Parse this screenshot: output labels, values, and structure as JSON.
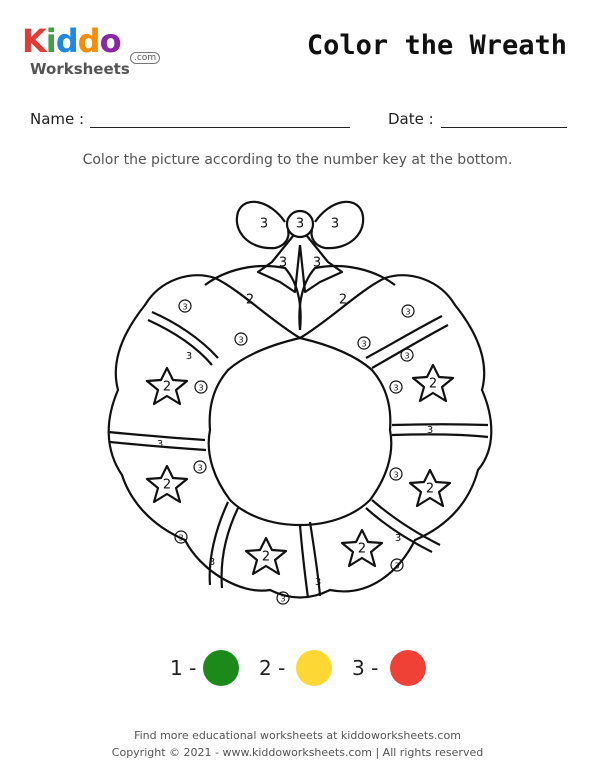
{
  "logo": {
    "word": [
      "K",
      "i",
      "d",
      "d",
      "o"
    ],
    "sub": "Worksheets",
    "com": ".com"
  },
  "title": "Color the Wreath",
  "form": {
    "name_label": "Name :",
    "date_label": "Date :"
  },
  "instructions": "Color the picture according to the number key at the bottom.",
  "wreath_numbers": [
    "3",
    "3",
    "3",
    "3",
    "3",
    "2",
    "2",
    "3",
    "3",
    "3",
    "3",
    "3",
    "2",
    "3",
    "3",
    "3",
    "2",
    "3",
    "3",
    "3",
    "3",
    "2",
    "2",
    "3",
    "3",
    "3",
    "3",
    "3",
    "2",
    "3",
    "3",
    "3",
    "3",
    "3",
    "2",
    "3"
  ],
  "key": [
    {
      "label": "1 -",
      "color": "#1b8a1b"
    },
    {
      "label": "2 -",
      "color": "#fdd835"
    },
    {
      "label": "3 -",
      "color": "#ef4136"
    }
  ],
  "footer": {
    "line1": "Find more educational worksheets at kiddoworksheets.com",
    "line2": "Copyright © 2021 - www.kiddoworksheets.com  |  All rights reserved"
  }
}
